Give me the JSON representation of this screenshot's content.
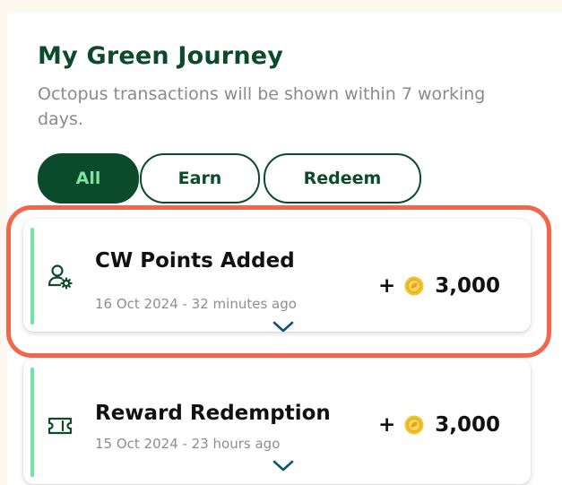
{
  "header": {
    "title": "My Green Journey",
    "subtitle": "Octopus transactions will be shown within 7 working days."
  },
  "filters": [
    {
      "label": "All",
      "active": true
    },
    {
      "label": "Earn",
      "active": false
    },
    {
      "label": "Redeem",
      "active": false
    }
  ],
  "transactions": [
    {
      "icon": "user-gear-icon",
      "title": "CW Points Added",
      "date": "16 Oct 2024 - 32 minutes ago",
      "sign": "+",
      "points": "3,000",
      "highlighted": true
    },
    {
      "icon": "ticket-icon",
      "title": "Reward Redemption",
      "date": "15 Oct 2024 - 23 hours ago",
      "sign": "+",
      "points": "3,000",
      "highlighted": false
    }
  ],
  "colors": {
    "primary": "#0c4a2c",
    "accent": "#6fe3a0",
    "highlight": "#f4664c",
    "coin": "#f6c12e"
  }
}
